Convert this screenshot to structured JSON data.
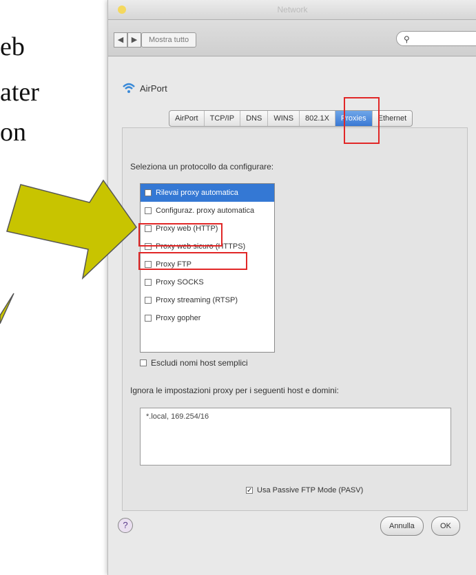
{
  "slide": {
    "fragments": [
      "eb",
      "ater",
      "on"
    ]
  },
  "window": {
    "title": "Network",
    "nav_back": "◀",
    "nav_fwd": "▶",
    "show_all": "Mostra tutto",
    "search_placeholder": "",
    "interface_name": "AirPort",
    "tabs": [
      "AirPort",
      "TCP/IP",
      "DNS",
      "WINS",
      "802.1X",
      "Proxies",
      "Ethernet"
    ],
    "active_tab": "Proxies",
    "protocol_prompt": "Seleziona un protocollo da configurare:",
    "protocols": [
      {
        "label": "Rilevai proxy automatica",
        "checked": false,
        "selected": true
      },
      {
        "label": "Configuraz. proxy automatica",
        "checked": false,
        "selected": false
      },
      {
        "label": "Proxy web (HTTP)",
        "checked": false,
        "selected": false
      },
      {
        "label": "Proxy web sicuro (HTTPS)",
        "checked": false,
        "selected": false
      },
      {
        "label": "Proxy FTP",
        "checked": false,
        "selected": false
      },
      {
        "label": "Proxy SOCKS",
        "checked": false,
        "selected": false
      },
      {
        "label": "Proxy streaming (RTSP)",
        "checked": false,
        "selected": false
      },
      {
        "label": "Proxy gopher",
        "checked": false,
        "selected": false
      }
    ],
    "exclude_simple": "Escludi nomi host semplici",
    "bypass_label": "Ignora le impostazioni proxy per i seguenti host e domini:",
    "bypass_value": "*.local, 169.254/16",
    "pasv_label": "Usa Passive FTP Mode (PASV)",
    "help": "?",
    "cancel": "Annulla",
    "ok": "OK"
  },
  "colors": {
    "arrow_fill": "#c8c400",
    "highlight": "#e12626",
    "selection": "#3478d4"
  }
}
